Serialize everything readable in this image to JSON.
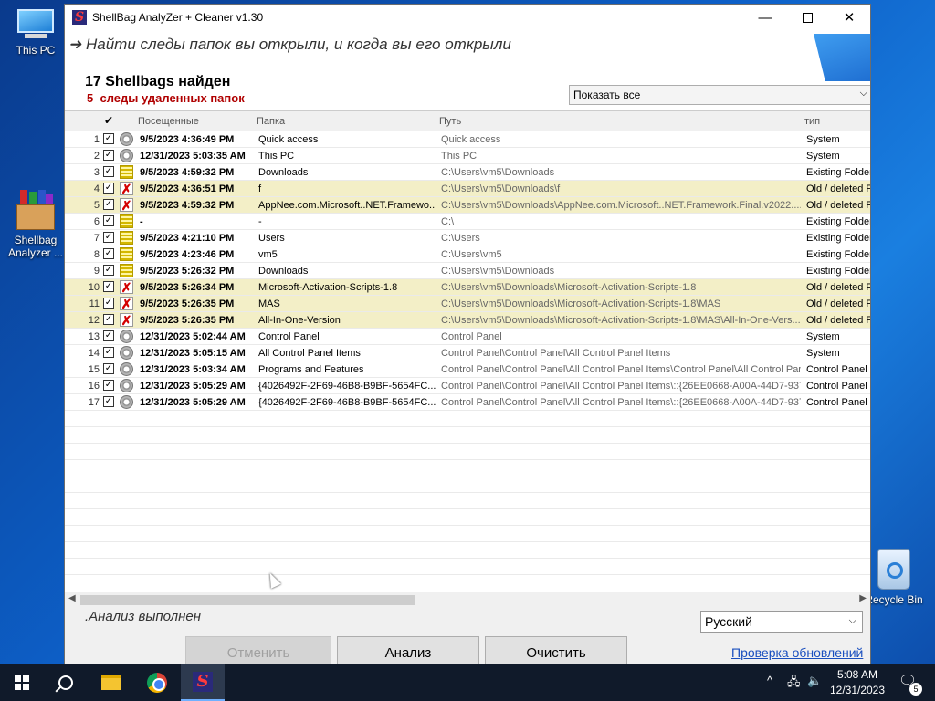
{
  "desktop": {
    "icons": [
      {
        "label": "This PC"
      },
      {
        "label": "Shellbag Analyzer ..."
      },
      {
        "label": "Recycle Bin"
      }
    ]
  },
  "window": {
    "title": "ShellBag  AnalyZer + Cleaner v1.30",
    "tagline": "➜ Найти следы папок вы открыли, и когда вы его открыли",
    "count_title": "17 Shellbags найден",
    "deleted_count": "5",
    "deleted_label": "следы удаленных папок",
    "filter": {
      "selected": "Показать все"
    },
    "columns": {
      "visited": "Посещенные",
      "folder": "Папка",
      "path": "Путь",
      "type": "тип",
      "check_all": "✔"
    },
    "rows": [
      {
        "num": "1",
        "icon": "system",
        "date": "9/5/2023 4:36:49 PM",
        "folder": "Quick access",
        "path": "Quick access",
        "type": "System",
        "deleted": false
      },
      {
        "num": "2",
        "icon": "system",
        "date": "12/31/2023 5:03:35 AM",
        "folder": "This PC",
        "path": "This PC",
        "type": "System",
        "deleted": false
      },
      {
        "num": "3",
        "icon": "folder",
        "date": "9/5/2023 4:59:32 PM",
        "folder": "Downloads",
        "path": "C:\\Users\\vm5\\Downloads",
        "type": "Existing Folders",
        "deleted": false
      },
      {
        "num": "4",
        "icon": "deleted",
        "date": "9/5/2023 4:36:51 PM",
        "folder": "f",
        "path": "C:\\Users\\vm5\\Downloads\\f",
        "type": "Old / deleted Fo",
        "deleted": true
      },
      {
        "num": "5",
        "icon": "deleted",
        "date": "9/5/2023 4:59:32 PM",
        "folder": "AppNee.com.Microsoft..NET.Framewo...",
        "path": "C:\\Users\\vm5\\Downloads\\AppNee.com.Microsoft..NET.Framework.Final.v2022....",
        "type": "Old / deleted Fo",
        "deleted": true
      },
      {
        "num": "6",
        "icon": "folder",
        "date": "-",
        "folder": "-",
        "path": "C:\\",
        "type": "Existing Folders",
        "deleted": false
      },
      {
        "num": "7",
        "icon": "folder",
        "date": "9/5/2023 4:21:10 PM",
        "folder": "Users",
        "path": "C:\\Users",
        "type": "Existing Folders",
        "deleted": false
      },
      {
        "num": "8",
        "icon": "folder",
        "date": "9/5/2023 4:23:46 PM",
        "folder": "vm5",
        "path": "C:\\Users\\vm5",
        "type": "Existing Folders",
        "deleted": false
      },
      {
        "num": "9",
        "icon": "folder",
        "date": "9/5/2023 5:26:32 PM",
        "folder": "Downloads",
        "path": "C:\\Users\\vm5\\Downloads",
        "type": "Existing Folders",
        "deleted": false
      },
      {
        "num": "10",
        "icon": "deleted",
        "date": "9/5/2023 5:26:34 PM",
        "folder": "Microsoft-Activation-Scripts-1.8",
        "path": "C:\\Users\\vm5\\Downloads\\Microsoft-Activation-Scripts-1.8",
        "type": "Old / deleted Fo",
        "deleted": true
      },
      {
        "num": "11",
        "icon": "deleted",
        "date": "9/5/2023 5:26:35 PM",
        "folder": "MAS",
        "path": "C:\\Users\\vm5\\Downloads\\Microsoft-Activation-Scripts-1.8\\MAS",
        "type": "Old / deleted Fo",
        "deleted": true
      },
      {
        "num": "12",
        "icon": "deleted",
        "date": "9/5/2023 5:26:35 PM",
        "folder": "All-In-One-Version",
        "path": "C:\\Users\\vm5\\Downloads\\Microsoft-Activation-Scripts-1.8\\MAS\\All-In-One-Vers...",
        "type": "Old / deleted Fo",
        "deleted": true
      },
      {
        "num": "13",
        "icon": "system",
        "date": "12/31/2023 5:02:44 AM",
        "folder": "Control Panel",
        "path": "Control Panel",
        "type": "System",
        "deleted": false
      },
      {
        "num": "14",
        "icon": "system",
        "date": "12/31/2023 5:05:15 AM",
        "folder": "All Control Panel Items",
        "path": "Control Panel\\Control Panel\\All Control Panel Items",
        "type": "System",
        "deleted": false
      },
      {
        "num": "15",
        "icon": "system",
        "date": "12/31/2023 5:03:34 AM",
        "folder": "Programs and Features",
        "path": "Control Panel\\Control Panel\\All Control Panel Items\\Control Panel\\All Control Panel...",
        "type": "Control Panel",
        "deleted": false
      },
      {
        "num": "16",
        "icon": "system",
        "date": "12/31/2023 5:05:29 AM",
        "folder": "{4026492F-2F69-46B8-B9BF-5654FC...",
        "path": "Control Panel\\Control Panel\\All Control Panel Items\\::{26EE0668-A00A-44D7-937...",
        "type": "Control Panel",
        "deleted": false
      },
      {
        "num": "17",
        "icon": "system",
        "date": "12/31/2023 5:05:29 AM",
        "folder": "{4026492F-2F69-46B8-B9BF-5654FC...",
        "path": "Control Panel\\Control Panel\\All Control Panel Items\\::{26EE0668-A00A-44D7-937...",
        "type": "Control Panel",
        "deleted": false
      }
    ],
    "status": ".Анализ выполнен",
    "language": {
      "selected": "Русский"
    },
    "buttons": {
      "cancel": "Отменить",
      "analyze": "Анализ",
      "clean": "Очистить"
    },
    "update_link": "Проверка обновлений"
  },
  "taskbar": {
    "clock_time": "5:08 AM",
    "clock_date": "12/31/2023",
    "notification_count": "5"
  }
}
